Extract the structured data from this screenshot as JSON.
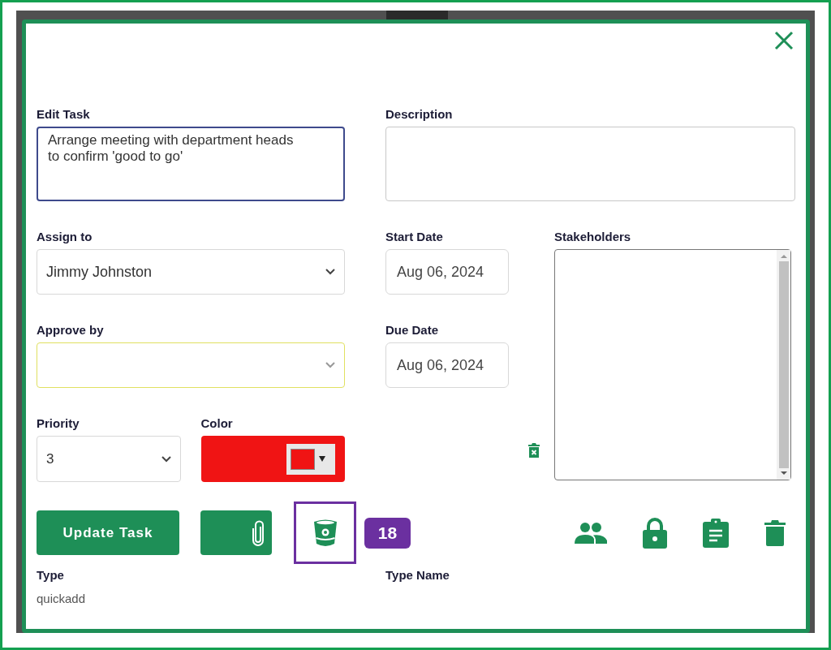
{
  "edit_task": {
    "label": "Edit Task",
    "value": "Arrange meeting with department heads to confirm 'good to go'"
  },
  "description": {
    "label": "Description"
  },
  "assign_to": {
    "label": "Assign to",
    "value": "Jimmy Johnston"
  },
  "start_date": {
    "label": "Start Date",
    "value": "Aug 06, 2024"
  },
  "stakeholders": {
    "label": "Stakeholders"
  },
  "approve_by": {
    "label": "Approve by"
  },
  "due_date": {
    "label": "Due Date",
    "value": "Aug 06, 2024"
  },
  "priority": {
    "label": "Priority",
    "value": "3"
  },
  "color_picker": {
    "label": "Color",
    "color": "#f01414"
  },
  "update_button": "Update Task",
  "badge": "18",
  "type": {
    "label": "Type",
    "value": "quickadd"
  },
  "type_name": {
    "label": "Type Name"
  }
}
